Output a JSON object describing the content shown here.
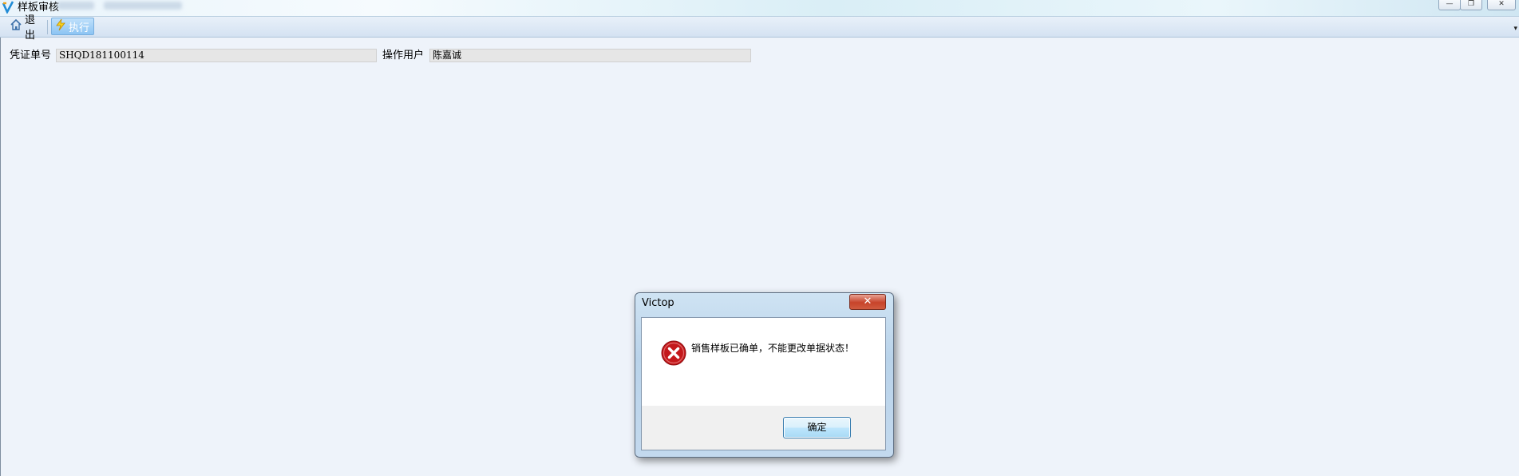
{
  "window": {
    "title": "样板审核",
    "controls": {
      "minimize": "—",
      "restore": "❐",
      "close": "✕"
    }
  },
  "toolbar": {
    "exit_label": "退出",
    "execute_label": "执行",
    "menu_arrow": "▾"
  },
  "form": {
    "voucher_label": "凭证单号",
    "voucher_value": "SHQD181100114",
    "operator_label": "操作用户",
    "operator_value": "陈嘉诚"
  },
  "dialog": {
    "title": "Victop",
    "message": "销售样板已确单，不能更改单据状态！",
    "ok_label": "确定",
    "close_glyph": "✕",
    "icon": "error-icon"
  },
  "colors": {
    "background": "#eef3fa",
    "accent": "#8cc4f3",
    "error_red": "#c4181b"
  }
}
